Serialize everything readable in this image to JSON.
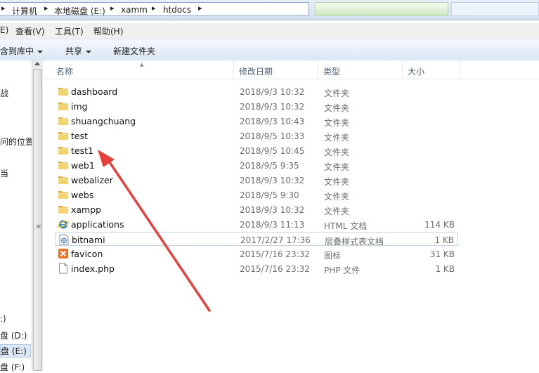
{
  "address": {
    "crumbs": [
      "计算机",
      "本地磁盘 (E:)",
      "xamm",
      "htdocs"
    ],
    "separator": "▸"
  },
  "menu": [
    "E)",
    "查看(V)",
    "工具(T)",
    "帮助(H)"
  ],
  "toolbar": {
    "include_label": "含到库中",
    "share_label": "共享",
    "newfolder_label": "新建文件夹"
  },
  "nav": {
    "items": [
      "战",
      "问的位置",
      "当",
      ":)",
      "盘 (D:)",
      "盘 (E:)",
      "盘 (F:)"
    ]
  },
  "columns": {
    "name": "名称",
    "date": "修改日期",
    "type": "类型",
    "size": "大小"
  },
  "files": [
    {
      "name": "dashboard",
      "date": "2018/9/3 10:32",
      "type": "文件夹",
      "size": "",
      "icon": "folder-icon"
    },
    {
      "name": "img",
      "date": "2018/9/3 10:32",
      "type": "文件夹",
      "size": "",
      "icon": "folder-icon"
    },
    {
      "name": "shuangchuang",
      "date": "2018/9/3 10:43",
      "type": "文件夹",
      "size": "",
      "icon": "folder-icon"
    },
    {
      "name": "test",
      "date": "2018/9/5 10:33",
      "type": "文件夹",
      "size": "",
      "icon": "folder-icon"
    },
    {
      "name": "test1",
      "date": "2018/9/5 10:45",
      "type": "文件夹",
      "size": "",
      "icon": "folder-icon"
    },
    {
      "name": "web1",
      "date": "2018/9/5 9:35",
      "type": "文件夹",
      "size": "",
      "icon": "folder-icon"
    },
    {
      "name": "webalizer",
      "date": "2018/9/3 10:32",
      "type": "文件夹",
      "size": "",
      "icon": "folder-icon"
    },
    {
      "name": "webs",
      "date": "2018/9/5 9:30",
      "type": "文件夹",
      "size": "",
      "icon": "folder-icon"
    },
    {
      "name": "xampp",
      "date": "2018/9/3 10:32",
      "type": "文件夹",
      "size": "",
      "icon": "folder-icon"
    },
    {
      "name": "applications",
      "date": "2018/9/3 11:13",
      "type": "HTML 文档",
      "size": "114 KB",
      "icon": "ie-html-icon"
    },
    {
      "name": "bitnami",
      "date": "2017/2/27 17:36",
      "type": "层叠样式表文档",
      "size": "1 KB",
      "icon": "css-file-icon"
    },
    {
      "name": "favicon",
      "date": "2015/7/16 23:32",
      "type": "图标",
      "size": "31 KB",
      "icon": "xampp-icon"
    },
    {
      "name": "index.php",
      "date": "2015/7/16 23:32",
      "type": "PHP 文件",
      "size": "1 KB",
      "icon": "blank-file-icon"
    }
  ],
  "colors": {
    "annotation_arrow": "#e8403a",
    "folder": "#e8c35a"
  }
}
